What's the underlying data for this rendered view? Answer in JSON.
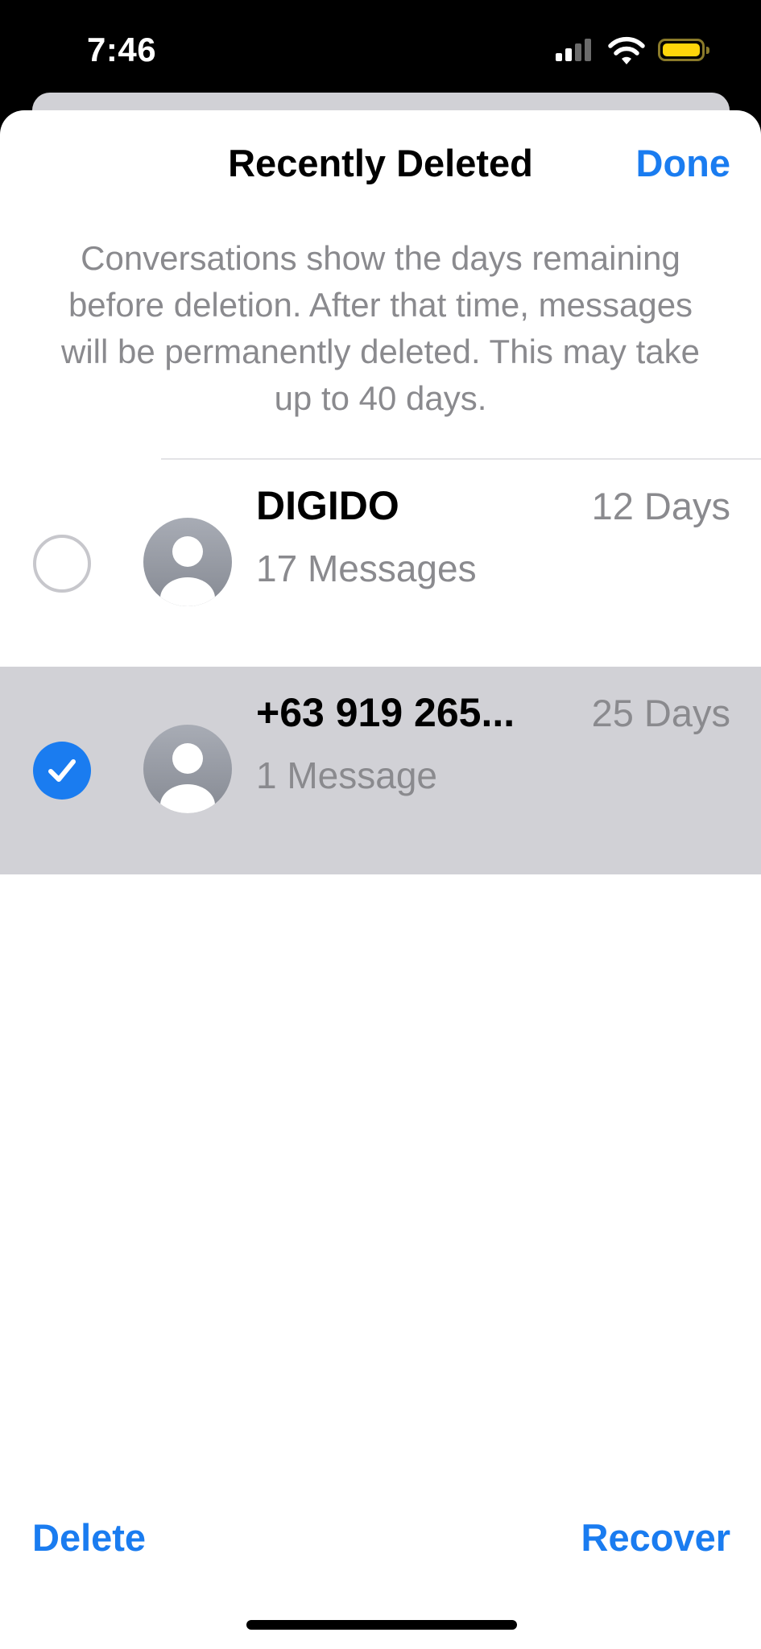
{
  "status_bar": {
    "time": "7:46"
  },
  "sheet": {
    "title": "Recently Deleted",
    "done_label": "Done",
    "info": "Conversations show the days remaining before deletion. After that time, messages will be permanently deleted. This may take up to 40 days."
  },
  "conversations": [
    {
      "name": "DIGIDO",
      "count": "17 Messages",
      "days": "12 Days",
      "selected": false
    },
    {
      "name": "+63 919 265...",
      "count": "1 Message",
      "days": "25 Days",
      "selected": true
    }
  ],
  "toolbar": {
    "delete_label": "Delete",
    "recover_label": "Recover"
  },
  "colors": {
    "accent": "#1a7cf0",
    "secondary_text": "#8a8a8e",
    "selected_row": "#d1d1d6",
    "battery": "#ffd60a"
  }
}
